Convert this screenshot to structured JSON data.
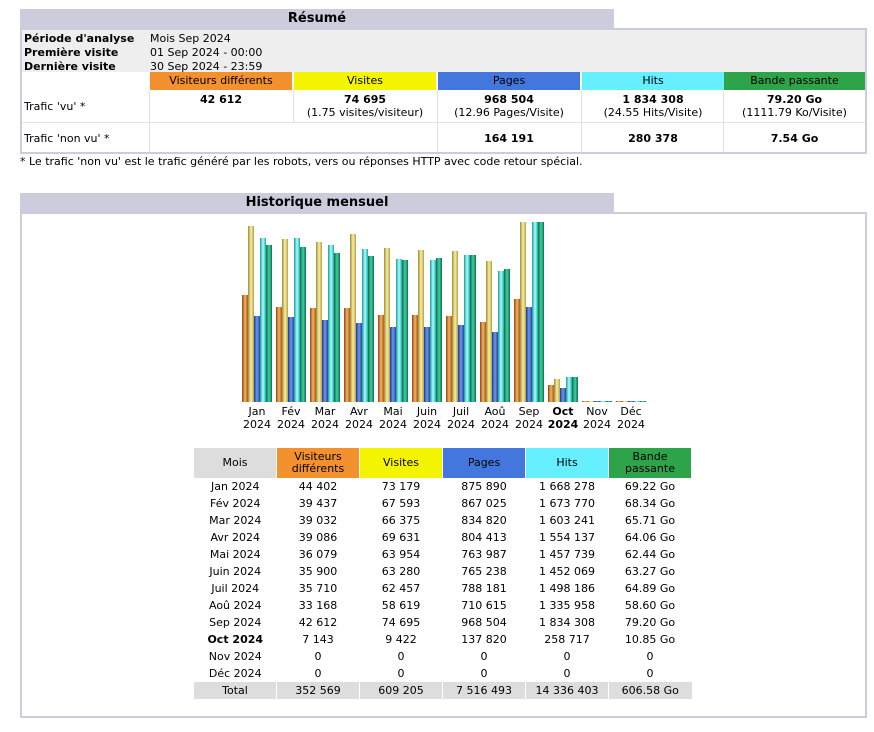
{
  "summary": {
    "title": "Résumé",
    "labels": {
      "period": "Période d'analyse",
      "first": "Première visite",
      "last": "Dernière visite"
    },
    "values": {
      "period": "Mois Sep 2024",
      "first": "01 Sep 2024 - 00:00",
      "last": "30 Sep 2024 - 23:59"
    },
    "headers": [
      "Visiteurs différents",
      "Visites",
      "Pages",
      "Hits",
      "Bande passante"
    ],
    "rows": [
      {
        "label": "Trafic 'vu' *",
        "cells": [
          {
            "main": "42 612",
            "sub": ""
          },
          {
            "main": "74 695",
            "sub": "(1.75 visites/visiteur)"
          },
          {
            "main": "968 504",
            "sub": "(12.96 Pages/Visite)"
          },
          {
            "main": "1 834 308",
            "sub": "(24.55 Hits/Visite)"
          },
          {
            "main": "79.20 Go",
            "sub": "(1111.79 Ko/Visite)"
          }
        ]
      },
      {
        "label": "Trafic 'non vu' *",
        "cells": [
          {
            "main": "",
            "sub": ""
          },
          {
            "main": "",
            "sub": ""
          },
          {
            "main": "164 191",
            "sub": ""
          },
          {
            "main": "280 378",
            "sub": ""
          },
          {
            "main": "7.54 Go",
            "sub": ""
          }
        ]
      }
    ],
    "footnote": "* Le trafic 'non vu' est le trafic généré par les robots, vers ou réponses HTTP avec code retour spécial."
  },
  "colors": {
    "visitors": "#f4912f",
    "visits": "#f4f400",
    "pages": "#4477dd",
    "hits": "#66f0ff",
    "bandwidth": "#2ea44a",
    "section": "#ccccdd",
    "light": "#eeeeee",
    "total": "#dddddd"
  },
  "history": {
    "title": "Historique mensuel",
    "table_headers": [
      "Mois",
      "Visiteurs différents",
      "Visites",
      "Pages",
      "Hits",
      "Bande passante"
    ],
    "total_label": "Total",
    "totals": [
      "352 569",
      "609 205",
      "7 516 493",
      "14 336 403",
      "606.58 Go"
    ]
  },
  "chart_data": {
    "type": "bar",
    "title": "Historique mensuel",
    "categories": [
      "Jan 2024",
      "Fév 2024",
      "Mar 2024",
      "Avr 2024",
      "Mai 2024",
      "Juin 2024",
      "Juil 2024",
      "Aoû 2024",
      "Sep 2024",
      "Oct 2024",
      "Nov 2024",
      "Déc 2024"
    ],
    "category_labels": [
      [
        "Jan",
        "2024"
      ],
      [
        "Fév",
        "2024"
      ],
      [
        "Mar",
        "2024"
      ],
      [
        "Avr",
        "2024"
      ],
      [
        "Mai",
        "2024"
      ],
      [
        "Juin",
        "2024"
      ],
      [
        "Juil",
        "2024"
      ],
      [
        "Aoû",
        "2024"
      ],
      [
        "Sep",
        "2024"
      ],
      [
        "Oct",
        "2024"
      ],
      [
        "Nov",
        "2024"
      ],
      [
        "Déc",
        "2024"
      ]
    ],
    "current_index": 9,
    "series": [
      {
        "name": "Visiteurs différents",
        "values": [
          44402,
          39437,
          39032,
          39086,
          36079,
          35900,
          35710,
          33168,
          42612,
          7143,
          0,
          0
        ],
        "labels": [
          "44 402",
          "39 437",
          "39 032",
          "39 086",
          "36 079",
          "35 900",
          "35 710",
          "33 168",
          "42 612",
          "7 143",
          "0",
          "0"
        ]
      },
      {
        "name": "Visites",
        "values": [
          73179,
          67593,
          66375,
          69631,
          63954,
          63280,
          62457,
          58619,
          74695,
          9422,
          0,
          0
        ],
        "labels": [
          "73 179",
          "67 593",
          "66 375",
          "69 631",
          "63 954",
          "63 280",
          "62 457",
          "58 619",
          "74 695",
          "9 422",
          "0",
          "0"
        ]
      },
      {
        "name": "Pages",
        "values": [
          875890,
          867025,
          834820,
          804413,
          763987,
          765238,
          788181,
          710615,
          968504,
          137820,
          0,
          0
        ],
        "labels": [
          "875 890",
          "867 025",
          "834 820",
          "804 413",
          "763 987",
          "765 238",
          "788 181",
          "710 615",
          "968 504",
          "137 820",
          "0",
          "0"
        ]
      },
      {
        "name": "Hits",
        "values": [
          1668278,
          1673770,
          1603241,
          1554137,
          1457739,
          1452069,
          1498186,
          1335958,
          1834308,
          258717,
          0,
          0
        ],
        "labels": [
          "1 668 278",
          "1 673 770",
          "1 603 241",
          "1 554 137",
          "1 457 739",
          "1 452 069",
          "1 498 186",
          "1 335 958",
          "1 834 308",
          "258 717",
          "0",
          "0"
        ]
      },
      {
        "name": "Bande passante",
        "unit": "Go",
        "values": [
          69.22,
          68.34,
          65.71,
          64.06,
          62.44,
          63.27,
          64.89,
          58.6,
          79.2,
          10.85,
          0,
          0
        ],
        "labels": [
          "69.22 Go",
          "68.34 Go",
          "65.71 Go",
          "64.06 Go",
          "62.44 Go",
          "63.27 Go",
          "64.89 Go",
          "58.60 Go",
          "79.20 Go",
          "10.85 Go",
          "0",
          "0"
        ]
      }
    ]
  }
}
